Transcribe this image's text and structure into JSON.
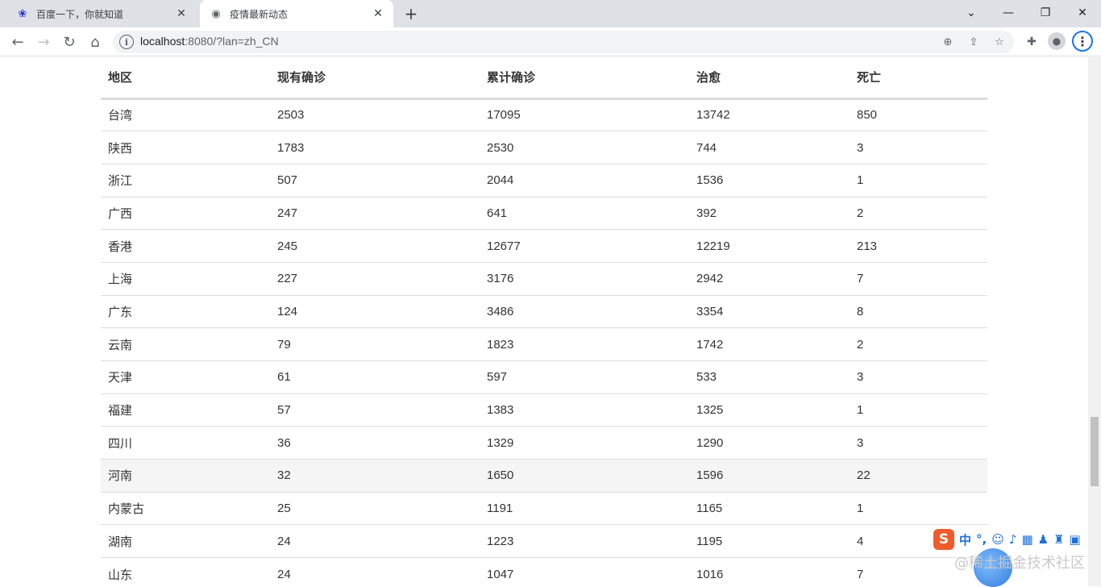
{
  "browser": {
    "tabs": [
      {
        "title": "百度一下，你就知道",
        "icon": "baidu-paw-icon"
      },
      {
        "title": "疫情最新动态",
        "icon": "globe-icon",
        "active": true
      }
    ],
    "url_host": "localhost",
    "url_rest": ":8080/?lan=zh_CN"
  },
  "table": {
    "headers": [
      "地区",
      "现有确诊",
      "累计确诊",
      "治愈",
      "死亡"
    ],
    "rows": [
      [
        "台湾",
        "2503",
        "17095",
        "13742",
        "850"
      ],
      [
        "陕西",
        "1783",
        "2530",
        "744",
        "3"
      ],
      [
        "浙江",
        "507",
        "2044",
        "1536",
        "1"
      ],
      [
        "广西",
        "247",
        "641",
        "392",
        "2"
      ],
      [
        "香港",
        "245",
        "12677",
        "12219",
        "213"
      ],
      [
        "上海",
        "227",
        "3176",
        "2942",
        "7"
      ],
      [
        "广东",
        "124",
        "3486",
        "3354",
        "8"
      ],
      [
        "云南",
        "79",
        "1823",
        "1742",
        "2"
      ],
      [
        "天津",
        "61",
        "597",
        "533",
        "3"
      ],
      [
        "福建",
        "57",
        "1383",
        "1325",
        "1"
      ],
      [
        "四川",
        "36",
        "1329",
        "1290",
        "3"
      ],
      [
        "河南",
        "32",
        "1650",
        "1596",
        "22"
      ],
      [
        "内蒙古",
        "25",
        "1191",
        "1165",
        "1"
      ],
      [
        "湖南",
        "24",
        "1223",
        "1195",
        "4"
      ],
      [
        "山东",
        "24",
        "1047",
        "1016",
        "7"
      ]
    ],
    "highlighted_row": 11
  },
  "ime": {
    "logo": "S",
    "mode": "中"
  },
  "watermark": "@稀土掘金技术社区"
}
